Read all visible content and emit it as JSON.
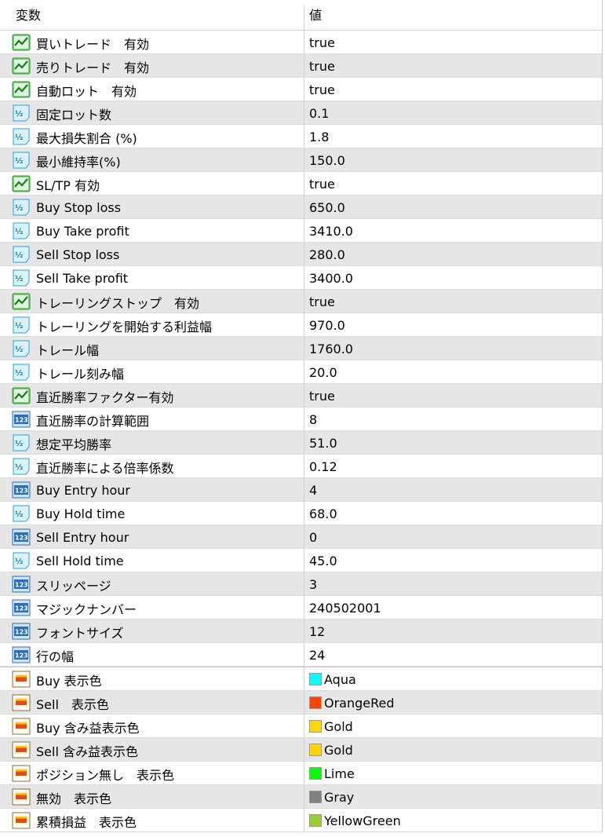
{
  "header": {
    "name_col": "変数",
    "value_col": "値"
  },
  "rows": [
    {
      "icon": "boolean-icon",
      "name": "買いトレード　有効",
      "value": "true"
    },
    {
      "icon": "boolean-icon",
      "name": "売りトレード　有効",
      "value": "true"
    },
    {
      "icon": "boolean-icon",
      "name": "自動ロット　有効",
      "value": "true"
    },
    {
      "icon": "double-icon",
      "name": "固定ロット数",
      "value": "0.1"
    },
    {
      "icon": "double-icon",
      "name": "最大損失割合 (%)",
      "value": "1.8"
    },
    {
      "icon": "double-icon",
      "name": "最小維持率(%)",
      "value": "150.0"
    },
    {
      "icon": "boolean-icon",
      "name": "SL/TP 有効",
      "value": "true"
    },
    {
      "icon": "double-icon",
      "name": "Buy Stop loss",
      "value": "650.0"
    },
    {
      "icon": "double-icon",
      "name": "Buy Take profit",
      "value": "3410.0"
    },
    {
      "icon": "double-icon",
      "name": "Sell Stop loss",
      "value": "280.0"
    },
    {
      "icon": "double-icon",
      "name": "Sell Take profit",
      "value": "3400.0"
    },
    {
      "icon": "boolean-icon",
      "name": "トレーリングストップ　有効",
      "value": "true"
    },
    {
      "icon": "double-icon",
      "name": "トレーリングを開始する利益幅",
      "value": "970.0"
    },
    {
      "icon": "double-icon",
      "name": "トレール幅",
      "value": "1760.0"
    },
    {
      "icon": "double-icon",
      "name": "トレール刻み幅",
      "value": "20.0"
    },
    {
      "icon": "boolean-icon",
      "name": "直近勝率ファクター有効",
      "value": "true"
    },
    {
      "icon": "integer-icon",
      "name": "直近勝率の計算範囲",
      "value": "8"
    },
    {
      "icon": "double-icon",
      "name": "想定平均勝率",
      "value": "51.0"
    },
    {
      "icon": "double-icon",
      "name": "直近勝率による倍率係数",
      "value": "0.12"
    },
    {
      "icon": "integer-icon",
      "name": "Buy Entry hour",
      "value": "4"
    },
    {
      "icon": "double-icon",
      "name": "Buy Hold time",
      "value": "68.0"
    },
    {
      "icon": "integer-icon",
      "name": "Sell Entry hour",
      "value": "0"
    },
    {
      "icon": "double-icon",
      "name": "Sell Hold time",
      "value": "45.0"
    },
    {
      "icon": "integer-icon",
      "name": "スリッページ",
      "value": "3"
    },
    {
      "icon": "integer-icon",
      "name": "マジックナンバー",
      "value": "240502001"
    },
    {
      "icon": "integer-icon",
      "name": "フォントサイズ",
      "value": "12"
    },
    {
      "icon": "integer-icon",
      "name": "行の幅",
      "value": "24"
    }
  ],
  "color_rows": [
    {
      "icon": "color-icon",
      "name": "Buy  表示色",
      "value": "Aqua",
      "color": "#00FFFF"
    },
    {
      "icon": "color-icon",
      "name": "Sell　表示色",
      "value": "OrangeRed",
      "color": "#FF4500"
    },
    {
      "icon": "color-icon",
      "name": "Buy  含み益表示色",
      "value": "Gold",
      "color": "#FFD700"
    },
    {
      "icon": "color-icon",
      "name": "Sell 含み益表示色",
      "value": "Gold",
      "color": "#FFD700"
    },
    {
      "icon": "color-icon",
      "name": "ポジション無し　表示色",
      "value": "Lime",
      "color": "#00FF00"
    },
    {
      "icon": "color-icon",
      "name": "無効　表示色",
      "value": "Gray",
      "color": "#808080"
    },
    {
      "icon": "color-icon",
      "name": "累積損益　表示色",
      "value": "YellowGreen",
      "color": "#9ACD32"
    }
  ]
}
